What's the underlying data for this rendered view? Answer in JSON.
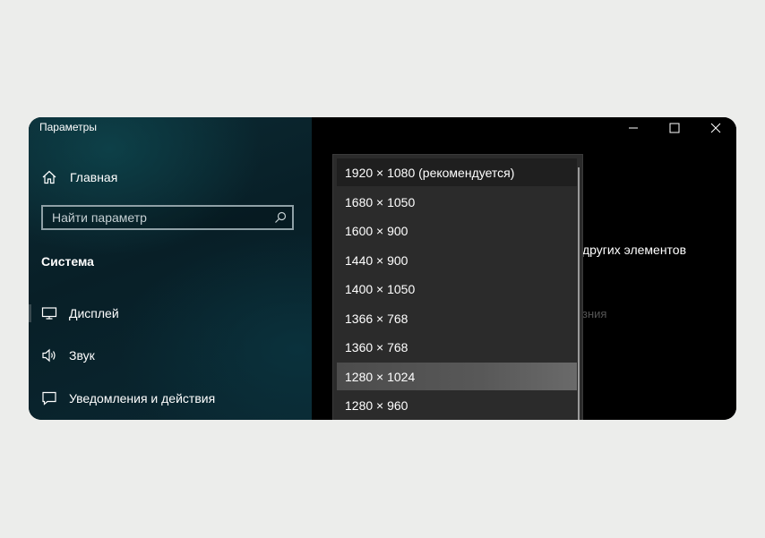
{
  "window": {
    "title": "Параметры",
    "controls": [
      "minimize",
      "maximize",
      "close"
    ]
  },
  "sidebar": {
    "home": {
      "label": "Главная",
      "icon": "home-icon"
    },
    "search": {
      "placeholder": "Найти параметр",
      "value": "",
      "icon": "search-icon"
    },
    "section_title": "Система",
    "items": [
      {
        "label": "Дисплей",
        "icon": "monitor-icon",
        "selected": true
      },
      {
        "label": "Звук",
        "icon": "speaker-icon",
        "selected": false
      },
      {
        "label": "Уведомления и действия",
        "icon": "notification-icon",
        "selected": false
      }
    ]
  },
  "content": {
    "background_text_1": "других элементов",
    "background_text_2": "зния"
  },
  "resolution_dropdown": {
    "selected": "1920 × 1080 (рекомендуется)",
    "hovered": "1280 × 1024",
    "options": [
      "1920 × 1080 (рекомендуется)",
      "1680 × 1050",
      "1600 × 900",
      "1440 × 900",
      "1400 × 1050",
      "1366 × 768",
      "1360 × 768",
      "1280 × 1024",
      "1280 × 960"
    ]
  },
  "colors": {
    "page_background": "#ecedeb",
    "sidebar_background": "#0a2731",
    "content_background": "#000000",
    "dropdown_background": "#2b2b2b",
    "dropdown_hover": "#585858"
  }
}
